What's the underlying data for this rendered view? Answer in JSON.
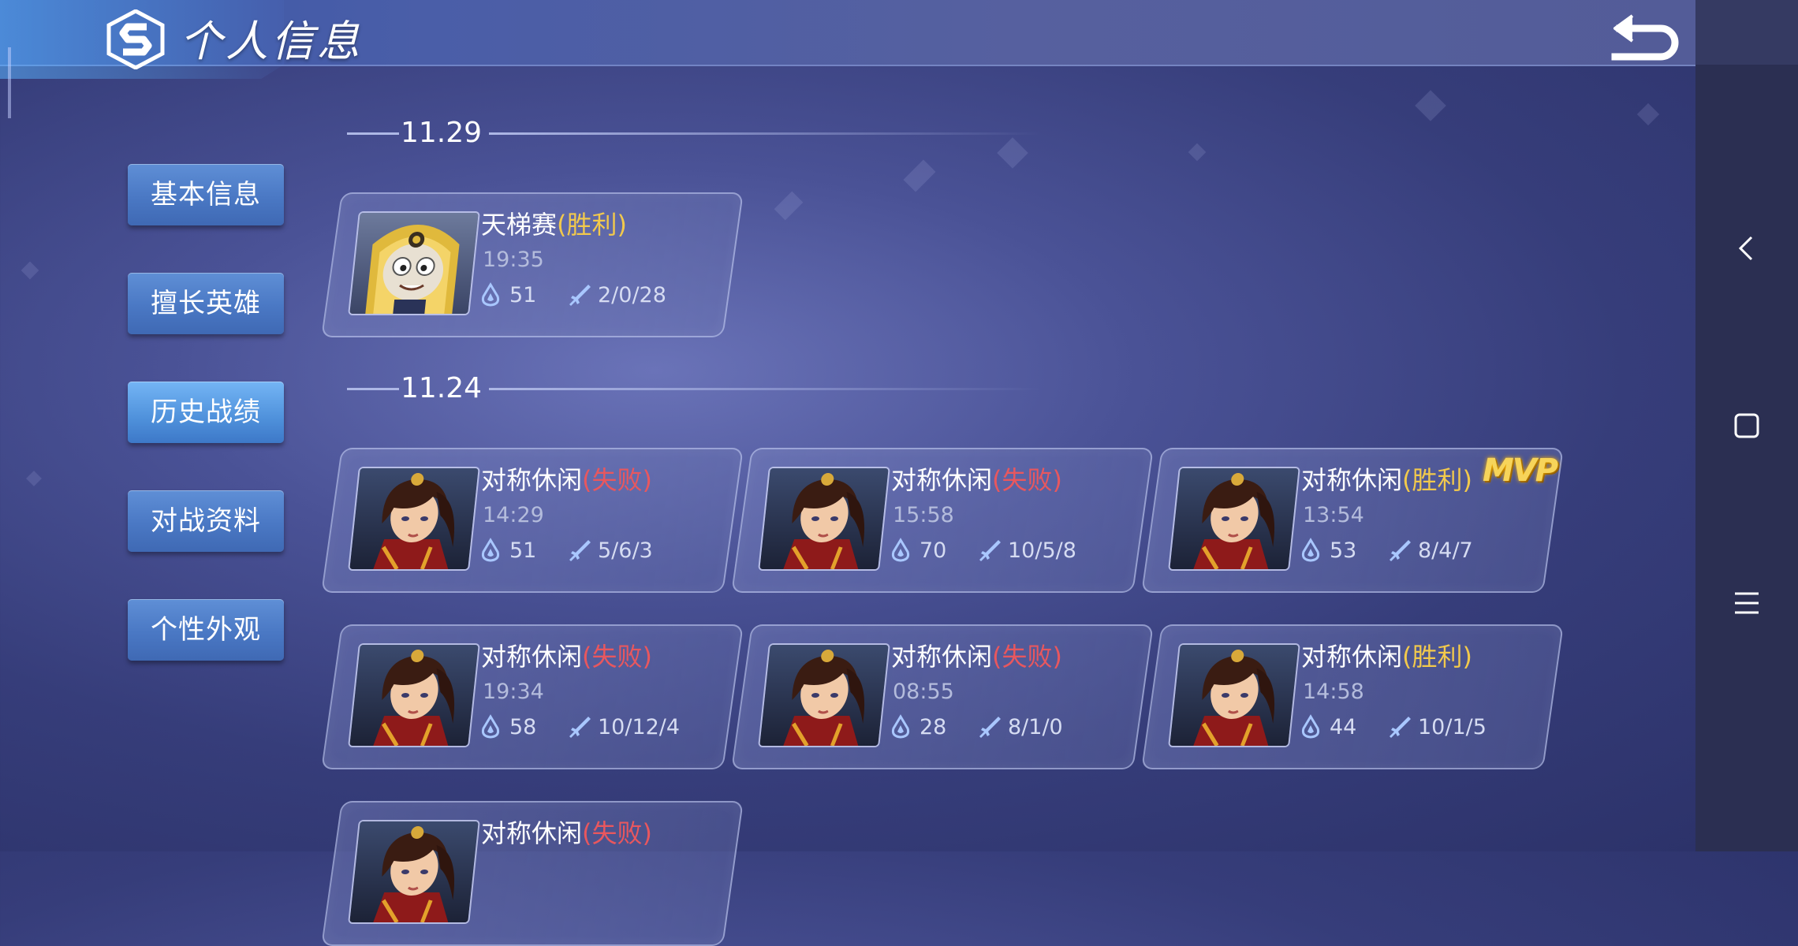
{
  "header": {
    "title": "个人信息"
  },
  "menu": {
    "items": [
      {
        "label": "基本信息"
      },
      {
        "label": "擅长英雄"
      },
      {
        "label": "历史战绩"
      },
      {
        "label": "对战资料"
      },
      {
        "label": "个性外观"
      }
    ],
    "active_index": 2
  },
  "sections": [
    {
      "date": "11.29",
      "matches": [
        {
          "mode": "天梯赛",
          "result": "(胜利)",
          "result_type": "win",
          "time": "19:35",
          "score": "51",
          "kda": "2/0/28",
          "hero": "yellow-hero"
        }
      ]
    },
    {
      "date": "11.24",
      "matches": [
        {
          "mode": "对称休闲",
          "result": "(失败)",
          "result_type": "loss",
          "time": "14:29",
          "score": "51",
          "kda": "5/6/3",
          "hero": "red-hero"
        },
        {
          "mode": "对称休闲",
          "result": "(失败)",
          "result_type": "loss",
          "time": "15:58",
          "score": "70",
          "kda": "10/5/8",
          "hero": "red-hero"
        },
        {
          "mode": "对称休闲",
          "result": "(胜利)",
          "result_type": "win",
          "time": "13:54",
          "score": "53",
          "kda": "8/4/7",
          "hero": "red-hero",
          "mvp": "MVP"
        },
        {
          "mode": "对称休闲",
          "result": "(失败)",
          "result_type": "loss",
          "time": "19:34",
          "score": "58",
          "kda": "10/12/4",
          "hero": "red-hero"
        },
        {
          "mode": "对称休闲",
          "result": "(失败)",
          "result_type": "loss",
          "time": "08:55",
          "score": "28",
          "kda": "8/1/0",
          "hero": "red-hero"
        },
        {
          "mode": "对称休闲",
          "result": "(胜利)",
          "result_type": "win",
          "time": "14:58",
          "score": "44",
          "kda": "10/1/5",
          "hero": "red-hero"
        },
        {
          "mode": "对称休闲",
          "result": "(失败)",
          "result_type": "loss",
          "time": "",
          "score": "",
          "kda": "",
          "hero": "red-hero"
        }
      ]
    }
  ],
  "colors": {
    "win": "#f2c94c",
    "loss": "#e8575e",
    "accent": "#4f91db"
  },
  "icons": {
    "back": "back-arrow-icon",
    "score": "flame-score-icon",
    "kda": "sword-icon",
    "logo": "s-logo-icon"
  },
  "system_nav": [
    "back-chevron-icon",
    "home-square-icon",
    "menu-lines-icon"
  ]
}
